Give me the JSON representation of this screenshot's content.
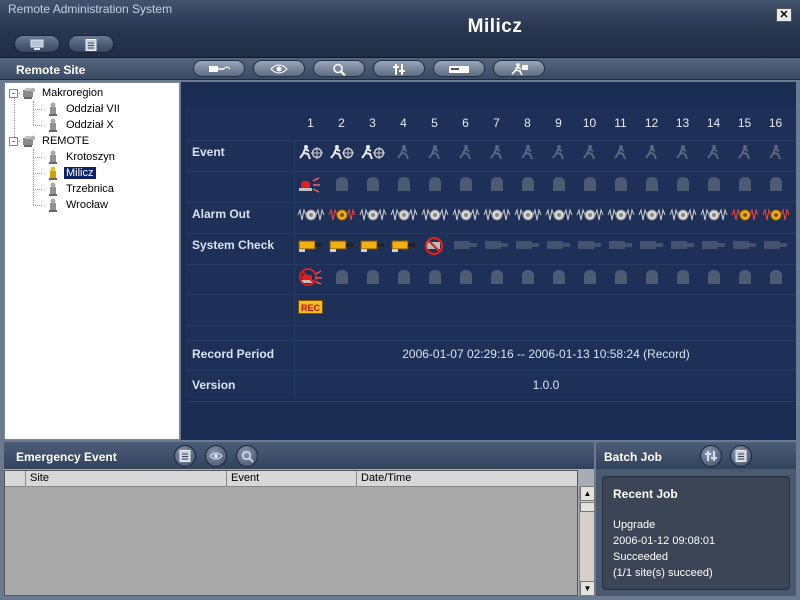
{
  "window": {
    "title": "Remote Administration System",
    "site_title": "Milicz",
    "close_label": "✕"
  },
  "sidebar": {
    "header": "Remote Site",
    "tree": [
      {
        "label": "Makroregion",
        "level": 0,
        "expander": "-"
      },
      {
        "label": "Oddział VII",
        "level": 1
      },
      {
        "label": "Oddział X",
        "level": 1
      },
      {
        "label": "REMOTE",
        "level": 0,
        "expander": "-"
      },
      {
        "label": "Krotoszyn",
        "level": 1
      },
      {
        "label": "Milicz",
        "level": 1,
        "selected": true
      },
      {
        "label": "Trzebnica",
        "level": 1
      },
      {
        "label": "Wrocław",
        "level": 1
      }
    ]
  },
  "toolbar": {
    "buttons": [
      "connect-icon",
      "monitor-icon",
      "search-icon",
      "settings-icon",
      "record-device-icon",
      "running-man-icon"
    ]
  },
  "main": {
    "channels": [
      "1",
      "2",
      "3",
      "4",
      "5",
      "6",
      "7",
      "8",
      "9",
      "10",
      "11",
      "12",
      "13",
      "14",
      "15",
      "16"
    ],
    "labels": {
      "event": "Event",
      "alarm_out": "Alarm Out",
      "system_check": "System Check",
      "record_period": "Record Period",
      "version": "Version"
    },
    "event_motion": [
      "active",
      "active",
      "active",
      "inactive",
      "inactive",
      "inactive",
      "inactive",
      "inactive",
      "inactive",
      "inactive",
      "inactive",
      "inactive",
      "inactive",
      "inactive",
      "inactive",
      "inactive"
    ],
    "event_alarm": [
      "active",
      "inactive",
      "inactive",
      "inactive",
      "inactive",
      "inactive",
      "inactive",
      "inactive",
      "inactive",
      "inactive",
      "inactive",
      "inactive",
      "inactive",
      "inactive",
      "inactive",
      "inactive"
    ],
    "alarm_out": [
      "normal",
      "triggered",
      "normal",
      "normal",
      "normal",
      "normal",
      "normal",
      "normal",
      "normal",
      "normal",
      "normal",
      "normal",
      "normal",
      "normal",
      "triggered",
      "triggered"
    ],
    "camera_check": [
      "ok",
      "ok",
      "ok",
      "ok",
      "error",
      "off",
      "off",
      "off",
      "off",
      "off",
      "off",
      "off",
      "off",
      "off",
      "off",
      "off"
    ],
    "sensor_check": [
      "error",
      "inactive",
      "inactive",
      "inactive",
      "inactive",
      "inactive",
      "inactive",
      "inactive",
      "inactive",
      "inactive",
      "inactive",
      "inactive",
      "inactive",
      "inactive",
      "inactive",
      "inactive"
    ],
    "rec_badge": "REC",
    "record_period_value": "2006-01-07 02:29:16 -- 2006-01-13 10:58:24 (Record)",
    "version_value": "1.0.0"
  },
  "emergency": {
    "title": "Emergency Event",
    "columns": [
      "Site",
      "Event",
      "Date/Time"
    ],
    "buttons": [
      "list-icon",
      "monitor-icon",
      "search-icon"
    ]
  },
  "batch": {
    "title": "Batch Job",
    "buttons": [
      "settings-icon",
      "list-icon"
    ],
    "recent_title": "Recent Job",
    "recent_lines": [
      "Upgrade",
      "2006-01-12 09:08:01",
      "Succeeded",
      "(1/1 site(s) succeed)"
    ]
  },
  "colors": {
    "panel": "#1c2d54",
    "accent": "#f0b010",
    "alarm": "#e02020",
    "selected": "#0a246a"
  }
}
